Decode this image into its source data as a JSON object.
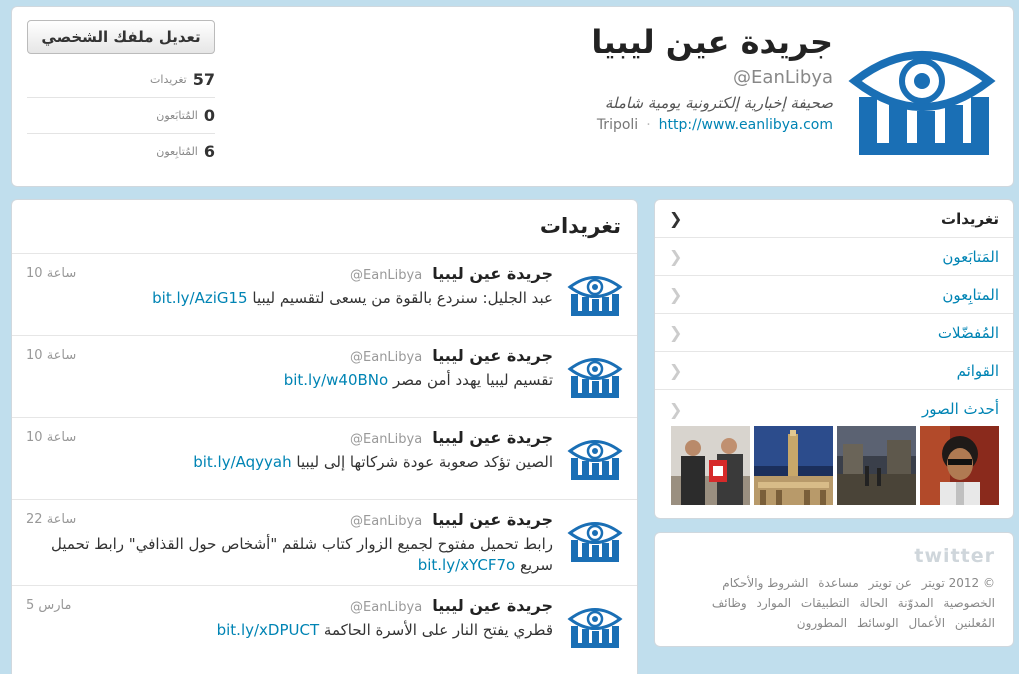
{
  "profile": {
    "name": "جريدة عين ليبيا",
    "handle": "@EanLibya",
    "bio": "صحيفة إخبارية إلكترونية يومية شاملة",
    "location": "Tripoli",
    "url": "http://www.eanlibya.com",
    "edit_button": "تعديل ملفك الشخصي",
    "stats": [
      {
        "num": "57",
        "label": "تغريدات"
      },
      {
        "num": "0",
        "label": "المُتابَعون"
      },
      {
        "num": "6",
        "label": "المُتابِعون"
      }
    ]
  },
  "tweets_panel": {
    "title": "تغريدات",
    "tweets": [
      {
        "name": "جريدة عين ليبيا",
        "handle": "@EanLibya",
        "time": "10 ساعة",
        "text": "عبد الجليل: سنردع بالقوة من يسعى لتقسيم ليبيا",
        "link": "bit.ly/AziG15"
      },
      {
        "name": "جريدة عين ليبيا",
        "handle": "@EanLibya",
        "time": "10 ساعة",
        "text": "تقسيم ليبيا يهدد أمن مصر",
        "link": "bit.ly/w40BNo"
      },
      {
        "name": "جريدة عين ليبيا",
        "handle": "@EanLibya",
        "time": "10 ساعة",
        "text": "الصين تؤكد صعوبة عودة شركاتها إلى ليبيا",
        "link": "bit.ly/Aqyyah"
      },
      {
        "name": "جريدة عين ليبيا",
        "handle": "@EanLibya",
        "time": "22 ساعة",
        "text": "رابط تحميل مفتوح لجميع الزوار كتاب شلقم \"أشخاص حول القذافي\" رابط تحميل سريع",
        "link": "bit.ly/xYCF7o"
      },
      {
        "name": "جريدة عين ليبيا",
        "handle": "@EanLibya",
        "time": "5 مارس",
        "text": "قطري يفتح النار على الأسرة الحاكمة",
        "link": "bit.ly/xDPUCT"
      }
    ]
  },
  "nav": {
    "items": [
      {
        "label": "تغريدات",
        "active": true
      },
      {
        "label": "المَتابَعون"
      },
      {
        "label": "المتابِعون"
      },
      {
        "label": "المُفضّلات"
      },
      {
        "label": "القوائم"
      },
      {
        "label": "أحدث الصور"
      }
    ],
    "chevron": "❯"
  },
  "footer": {
    "logo": "twitter",
    "links": [
      "© 2012 تويتر",
      "عن تويتر",
      "مساعدة",
      "الشروط والأحكام",
      "الخصوصية",
      "المدوّنة",
      "الحالة",
      "التطبيقات",
      "الموارد",
      "وظائف",
      "المُعلنين",
      "الأعمال",
      "الوسائط",
      "المطورون"
    ]
  },
  "colors": {
    "accent": "#0084b4",
    "background": "#c0deed",
    "logo_blue": "#1a6fb5"
  },
  "icons": {
    "avatar": "eanlibya-eye-logo",
    "chevron": "chevron-left-icon"
  }
}
